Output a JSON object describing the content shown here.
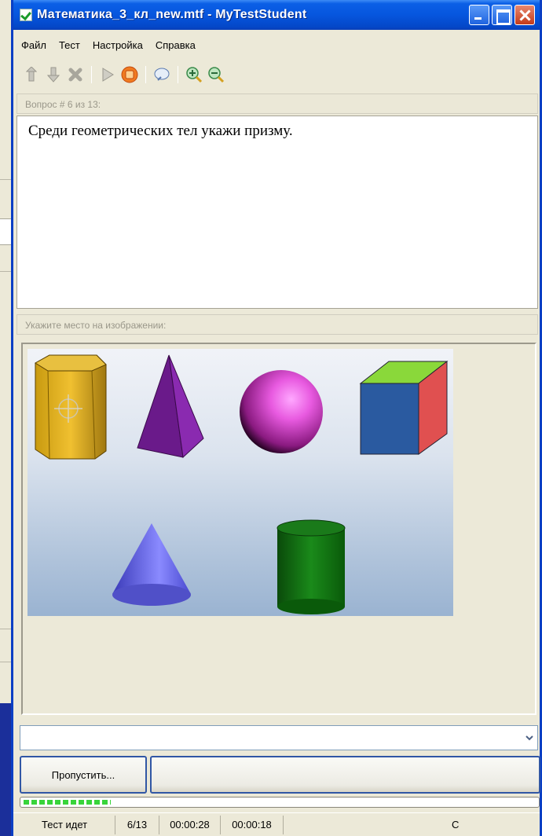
{
  "window": {
    "title": "Математика_3_кл_new.mtf - MyTestStudent"
  },
  "menu": [
    {
      "label": "Файл"
    },
    {
      "label": "Тест"
    },
    {
      "label": "Настройка"
    },
    {
      "label": "Справка"
    }
  ],
  "toolbar": [
    {
      "icon": "arrow-up-icon"
    },
    {
      "icon": "arrow-down-icon"
    },
    {
      "icon": "cross-icon"
    },
    {
      "icon": "play-icon"
    },
    {
      "icon": "stop-icon"
    },
    {
      "icon": "edit-icon"
    },
    {
      "icon": "zoom-in-icon"
    },
    {
      "icon": "zoom-out-icon"
    }
  ],
  "question": {
    "header": "Вопрос # 6 из 13:",
    "text": "Среди геометрических тел укажи призму."
  },
  "answer": {
    "header": "Укажите место на изображении:",
    "shapes": [
      "hexagonal-prism",
      "pyramid",
      "sphere",
      "cube",
      "cone",
      "cylinder"
    ]
  },
  "buttons": {
    "skip": "Пропустить...",
    "next": ""
  },
  "progress": {
    "value": 0.17
  },
  "status": {
    "state": "Тест идет",
    "counter": "6/13",
    "time_elapsed": "00:00:28",
    "time_question": "00:00:18",
    "extra": "С"
  },
  "colors": {
    "titlebar": "#0656de",
    "window_bg": "#ece9d8",
    "progress": "#38d43a"
  }
}
